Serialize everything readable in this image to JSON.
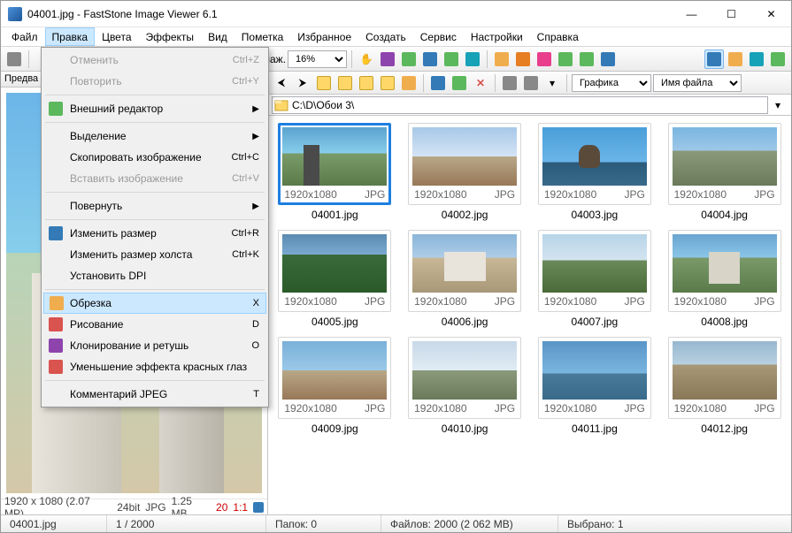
{
  "titlebar": {
    "title": "04001.jpg - FastStone Image Viewer 6.1"
  },
  "menubar": [
    "Файл",
    "Правка",
    "Цвета",
    "Эффекты",
    "Вид",
    "Пометка",
    "Избранное",
    "Создать",
    "Сервис",
    "Настройки",
    "Справка"
  ],
  "active_menu_index": 1,
  "dropdown": {
    "items": [
      {
        "label": "Отменить",
        "shortcut": "Ctrl+Z",
        "disabled": true
      },
      {
        "label": "Повторить",
        "shortcut": "Ctrl+Y",
        "disabled": true
      },
      {
        "sep": true
      },
      {
        "label": "Внешний редактор",
        "submenu": true,
        "icon": "grn"
      },
      {
        "sep": true
      },
      {
        "label": "Выделение",
        "submenu": true
      },
      {
        "label": "Скопировать изображение",
        "shortcut": "Ctrl+C"
      },
      {
        "label": "Вставить изображение",
        "shortcut": "Ctrl+V",
        "disabled": true
      },
      {
        "sep": true
      },
      {
        "label": "Повернуть",
        "submenu": true
      },
      {
        "sep": true
      },
      {
        "label": "Изменить размер",
        "shortcut": "Ctrl+R",
        "icon": "blu"
      },
      {
        "label": "Изменить размер холста",
        "shortcut": "Ctrl+K"
      },
      {
        "label": "Установить DPI"
      },
      {
        "sep": true
      },
      {
        "label": "Обрезка",
        "shortcut": "X",
        "icon": "yel",
        "hover": true
      },
      {
        "label": "Рисование",
        "shortcut": "D",
        "icon": "red"
      },
      {
        "label": "Клонирование и ретушь",
        "shortcut": "O",
        "icon": "pur"
      },
      {
        "label": "Уменьшение эффекта красных глаз",
        "icon": "red"
      },
      {
        "sep": true
      },
      {
        "label": "Комментарий JPEG",
        "shortcut": "T"
      }
    ]
  },
  "toolbar": {
    "zoom_label": "лаж.",
    "zoom_value": "16%"
  },
  "left": {
    "header": "Предва",
    "status": {
      "dims": "1920 x 1080 (2.07 MP)",
      "depth": "24bit",
      "fmt": "JPG",
      "size": "1.25 MB",
      "ratio": "20",
      "scale": "1:1"
    }
  },
  "nav": {
    "filter_label": "Графика",
    "sort_label": "Имя файла"
  },
  "path": "C:\\D\\Обои 3\\",
  "thumbs": [
    {
      "name": "04001.jpg",
      "res": "1920x1080",
      "fmt": "JPG",
      "cls": "t1",
      "selected": true
    },
    {
      "name": "04002.jpg",
      "res": "1920x1080",
      "fmt": "JPG",
      "cls": "t2"
    },
    {
      "name": "04003.jpg",
      "res": "1920x1080",
      "fmt": "JPG",
      "cls": "t3"
    },
    {
      "name": "04004.jpg",
      "res": "1920x1080",
      "fmt": "JPG",
      "cls": "t4"
    },
    {
      "name": "04005.jpg",
      "res": "1920x1080",
      "fmt": "JPG",
      "cls": "t5"
    },
    {
      "name": "04006.jpg",
      "res": "1920x1080",
      "fmt": "JPG",
      "cls": "t6"
    },
    {
      "name": "04007.jpg",
      "res": "1920x1080",
      "fmt": "JPG",
      "cls": "t7"
    },
    {
      "name": "04008.jpg",
      "res": "1920x1080",
      "fmt": "JPG",
      "cls": "t8"
    },
    {
      "name": "04009.jpg",
      "res": "1920x1080",
      "fmt": "JPG",
      "cls": "t9"
    },
    {
      "name": "04010.jpg",
      "res": "1920x1080",
      "fmt": "JPG",
      "cls": "t10"
    },
    {
      "name": "04011.jpg",
      "res": "1920x1080",
      "fmt": "JPG",
      "cls": "t11"
    },
    {
      "name": "04012.jpg",
      "res": "1920x1080",
      "fmt": "JPG",
      "cls": "t12"
    }
  ],
  "statusbar": {
    "file": "04001.jpg",
    "index": "1 / 2000",
    "folders": "Папок: 0",
    "files": "Файлов: 2000 (2 062 MB)",
    "selected": "Выбрано: 1"
  }
}
